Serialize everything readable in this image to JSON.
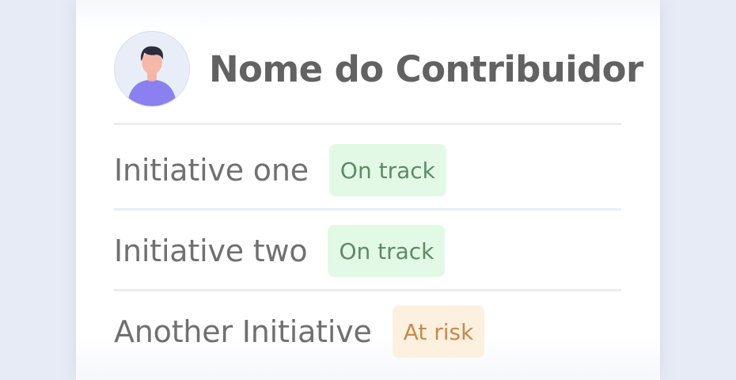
{
  "contributor": {
    "name": "Nome do Contribuidor"
  },
  "initiatives": [
    {
      "name": "Initiative one",
      "status": "On track",
      "status_color": "#5c8a66",
      "status_bg": "#e2f9e6"
    },
    {
      "name": "Initiative two",
      "status": "On track",
      "status_color": "#5c8a66",
      "status_bg": "#e2f9e6"
    },
    {
      "name": "Another Initiative",
      "status": "At risk",
      "status_color": "#c7894b",
      "status_bg": "#fdf0df"
    }
  ],
  "icons": {
    "avatar": "user-avatar-icon"
  }
}
